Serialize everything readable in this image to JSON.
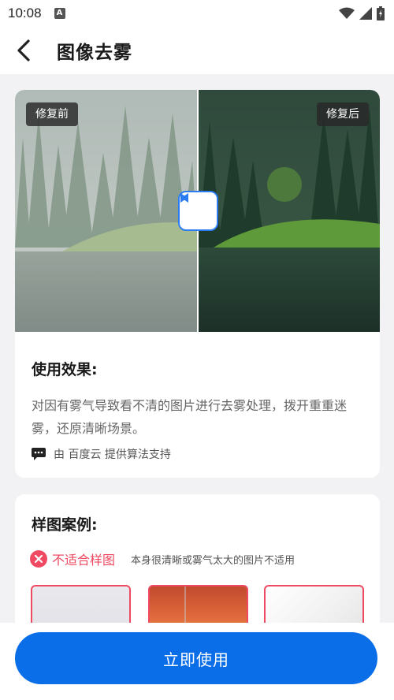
{
  "status_bar": {
    "time": "10:08",
    "notification_letter": "A"
  },
  "header": {
    "title": "图像去雾"
  },
  "compare": {
    "before_label": "修复前",
    "after_label": "修复后",
    "divider_position": 0.5
  },
  "effect": {
    "title": "使用效果:",
    "description": "对因有雾气导致看不清的图片进行去雾处理，拨开重重迷雾，还原清晰场景。",
    "provider": "由 百度云 提供算法支持"
  },
  "samples": {
    "title": "样图案例:",
    "unsuitable_label": "不适合样图",
    "unsuitable_desc": "本身很清晰或雾气太大的图片不适用"
  },
  "action": {
    "button_label": "立即使用"
  },
  "colors": {
    "accent": "#0a6ee8",
    "warning": "#ef4a62",
    "handle_border": "#2b7bf2"
  },
  "icons": [
    "back-arrow-icon",
    "wifi-icon",
    "signal-icon",
    "battery-icon",
    "chat-icon",
    "close-circle-icon",
    "arrow-left-icon",
    "arrow-right-icon"
  ]
}
